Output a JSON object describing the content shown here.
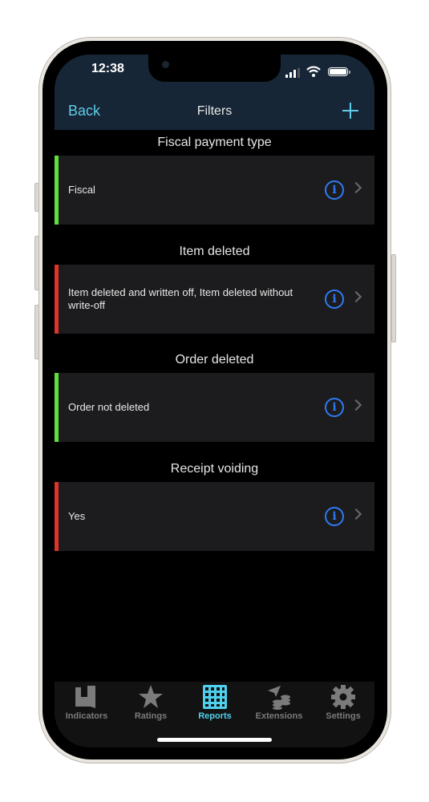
{
  "status_bar": {
    "time": "12:38"
  },
  "nav": {
    "back_label": "Back",
    "title": "Filters",
    "add_icon": "plus-icon"
  },
  "sections": [
    {
      "title": "Fiscal payment type",
      "value": "Fiscal",
      "indicator_color": "#5fe03b"
    },
    {
      "title": "Item deleted",
      "value": "Item deleted and written off, Item deleted without write-off",
      "indicator_color": "#e0332a"
    },
    {
      "title": "Order deleted",
      "value": "Order not deleted",
      "indicator_color": "#5fe03b"
    },
    {
      "title": "Receipt voiding",
      "value": "Yes",
      "indicator_color": "#e0332a"
    }
  ],
  "tabbar": {
    "active": "Reports",
    "items": [
      {
        "label": "Indicators",
        "icon": "indicators-icon"
      },
      {
        "label": "Ratings",
        "icon": "star-icon"
      },
      {
        "label": "Reports",
        "icon": "grid-icon"
      },
      {
        "label": "Extensions",
        "icon": "extensions-icon"
      },
      {
        "label": "Settings",
        "icon": "gear-icon"
      }
    ]
  },
  "colors": {
    "accent": "#5fcde8",
    "info": "#2f7af5",
    "header_bg": "#172636"
  }
}
